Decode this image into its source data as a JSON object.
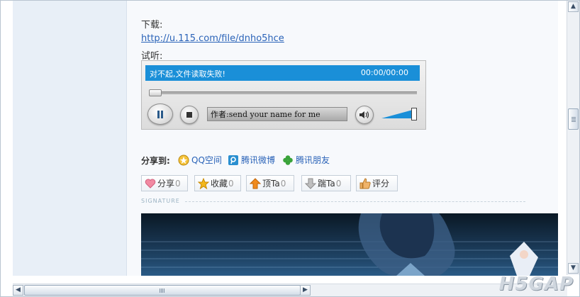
{
  "post": {
    "download_label": "下载:",
    "download_url": "http://u.115.com/file/dnho5hce",
    "listen_label": "试听:"
  },
  "player": {
    "status_message": "对不起,文件读取失败!",
    "time_display": "00:00/00:00",
    "track_title": "作者:send your name for me",
    "progress": 0,
    "volume": 1.0,
    "accent_color": "#1a8fd8"
  },
  "share": {
    "label": "分享到:",
    "items": [
      {
        "label": "QQ空间",
        "icon": "qzone-icon"
      },
      {
        "label": "腾讯微博",
        "icon": "tencent-weibo-icon"
      },
      {
        "label": "腾讯朋友",
        "icon": "clover-icon"
      }
    ]
  },
  "actions": [
    {
      "label": "分享",
      "count": "0",
      "icon": "heart-icon"
    },
    {
      "label": "收藏",
      "count": "0",
      "icon": "star-icon"
    },
    {
      "label": "顶Ta",
      "count": "0",
      "icon": "up-arrow-icon"
    },
    {
      "label": "踹Ta",
      "count": "0",
      "icon": "down-arrow-icon"
    },
    {
      "label": "评分",
      "count": "",
      "icon": "thumbs-up-icon"
    }
  ],
  "signature_label": "SIGNATURE",
  "watermark": "H5GAP"
}
